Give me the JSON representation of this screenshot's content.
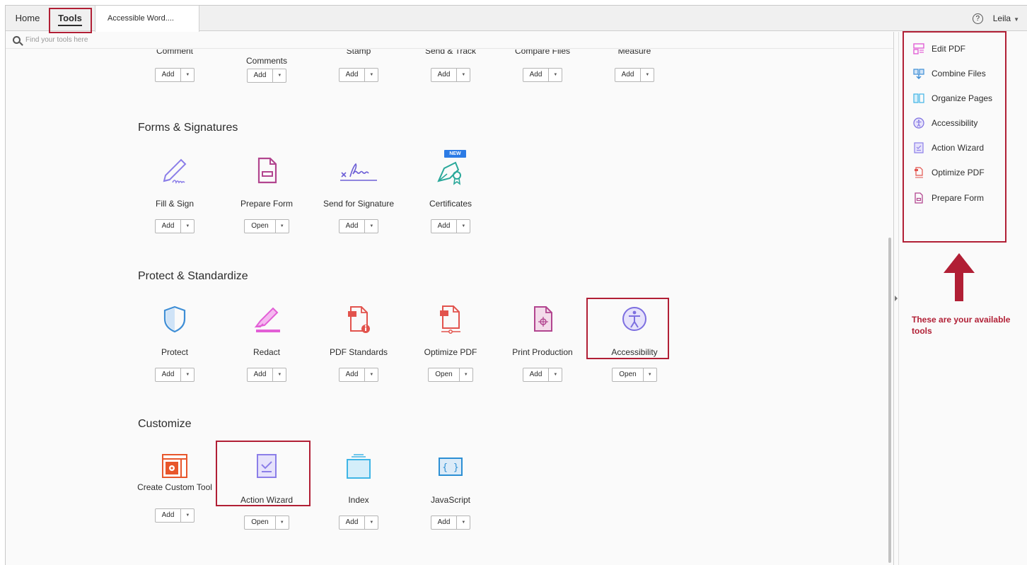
{
  "tabs": {
    "home": "Home",
    "tools": "Tools",
    "document": "Accessible Word...."
  },
  "user": {
    "help_icon": "?",
    "name": "Leila"
  },
  "search": {
    "placeholder": "Find your tools here"
  },
  "top_row": [
    {
      "label": "Comment",
      "button": "Add"
    },
    {
      "label": "Comments",
      "button": "Add"
    },
    {
      "label": "Stamp",
      "button": "Add"
    },
    {
      "label": "Send & Track",
      "button": "Add"
    },
    {
      "label": "Compare Files",
      "button": "Add"
    },
    {
      "label": "Measure",
      "button": "Add"
    }
  ],
  "sections": {
    "forms": {
      "title": "Forms & Signatures",
      "new_badge": "NEW",
      "tools": [
        {
          "label": "Fill & Sign",
          "button": "Add",
          "icon": "fill-sign-icon"
        },
        {
          "label": "Prepare Form",
          "button": "Open",
          "icon": "prepare-form-icon"
        },
        {
          "label": "Send for Signature",
          "button": "Add",
          "icon": "signature-icon"
        },
        {
          "label": "Certificates",
          "button": "Add",
          "icon": "certificate-icon"
        }
      ]
    },
    "protect": {
      "title": "Protect & Standardize",
      "tools": [
        {
          "label": "Protect",
          "button": "Add",
          "icon": "shield-icon"
        },
        {
          "label": "Redact",
          "button": "Add",
          "icon": "redact-marker-icon"
        },
        {
          "label": "PDF Standards",
          "button": "Add",
          "icon": "pdf-standards-icon"
        },
        {
          "label": "Optimize PDF",
          "button": "Open",
          "icon": "optimize-pdf-icon"
        },
        {
          "label": "Print Production",
          "button": "Add",
          "icon": "print-production-icon"
        },
        {
          "label": "Accessibility",
          "button": "Open",
          "icon": "accessibility-icon"
        }
      ]
    },
    "customize": {
      "title": "Customize",
      "tools": [
        {
          "label": "Create Custom Tool",
          "button": "Add",
          "icon": "custom-tool-icon"
        },
        {
          "label": "Action Wizard",
          "button": "Open",
          "icon": "action-wizard-icon"
        },
        {
          "label": "Index",
          "button": "Add",
          "icon": "index-icon"
        },
        {
          "label": "JavaScript",
          "button": "Add",
          "icon": "javascript-icon"
        }
      ]
    }
  },
  "right_panel": {
    "items": [
      {
        "label": "Edit PDF",
        "icon": "edit-pdf-icon"
      },
      {
        "label": "Combine Files",
        "icon": "combine-files-icon"
      },
      {
        "label": "Organize Pages",
        "icon": "organize-pages-icon"
      },
      {
        "label": "Accessibility",
        "icon": "accessibility-icon"
      },
      {
        "label": "Action Wizard",
        "icon": "action-wizard-icon"
      },
      {
        "label": "Optimize PDF",
        "icon": "optimize-pdf-icon"
      },
      {
        "label": "Prepare Form",
        "icon": "prepare-form-icon"
      }
    ],
    "annotation": "These are your available tools"
  },
  "colors": {
    "annotation_red": "#b11f35",
    "fill_sign": "#8b7ee8",
    "prepare_form": "#b2458f",
    "signature": "#6d5fd6",
    "certificate": "#2aa89a",
    "protect": "#3e8ed6",
    "redact": "#e25fd6",
    "pdf_standards": "#e2534d",
    "optimize": "#e2534d",
    "print": "#b2458f",
    "accessibility": "#7d6fe0",
    "custom_tool": "#e8562b",
    "action_wizard": "#8b7ee8",
    "index": "#3fb5e6",
    "javascript": "#2c8fd4"
  }
}
